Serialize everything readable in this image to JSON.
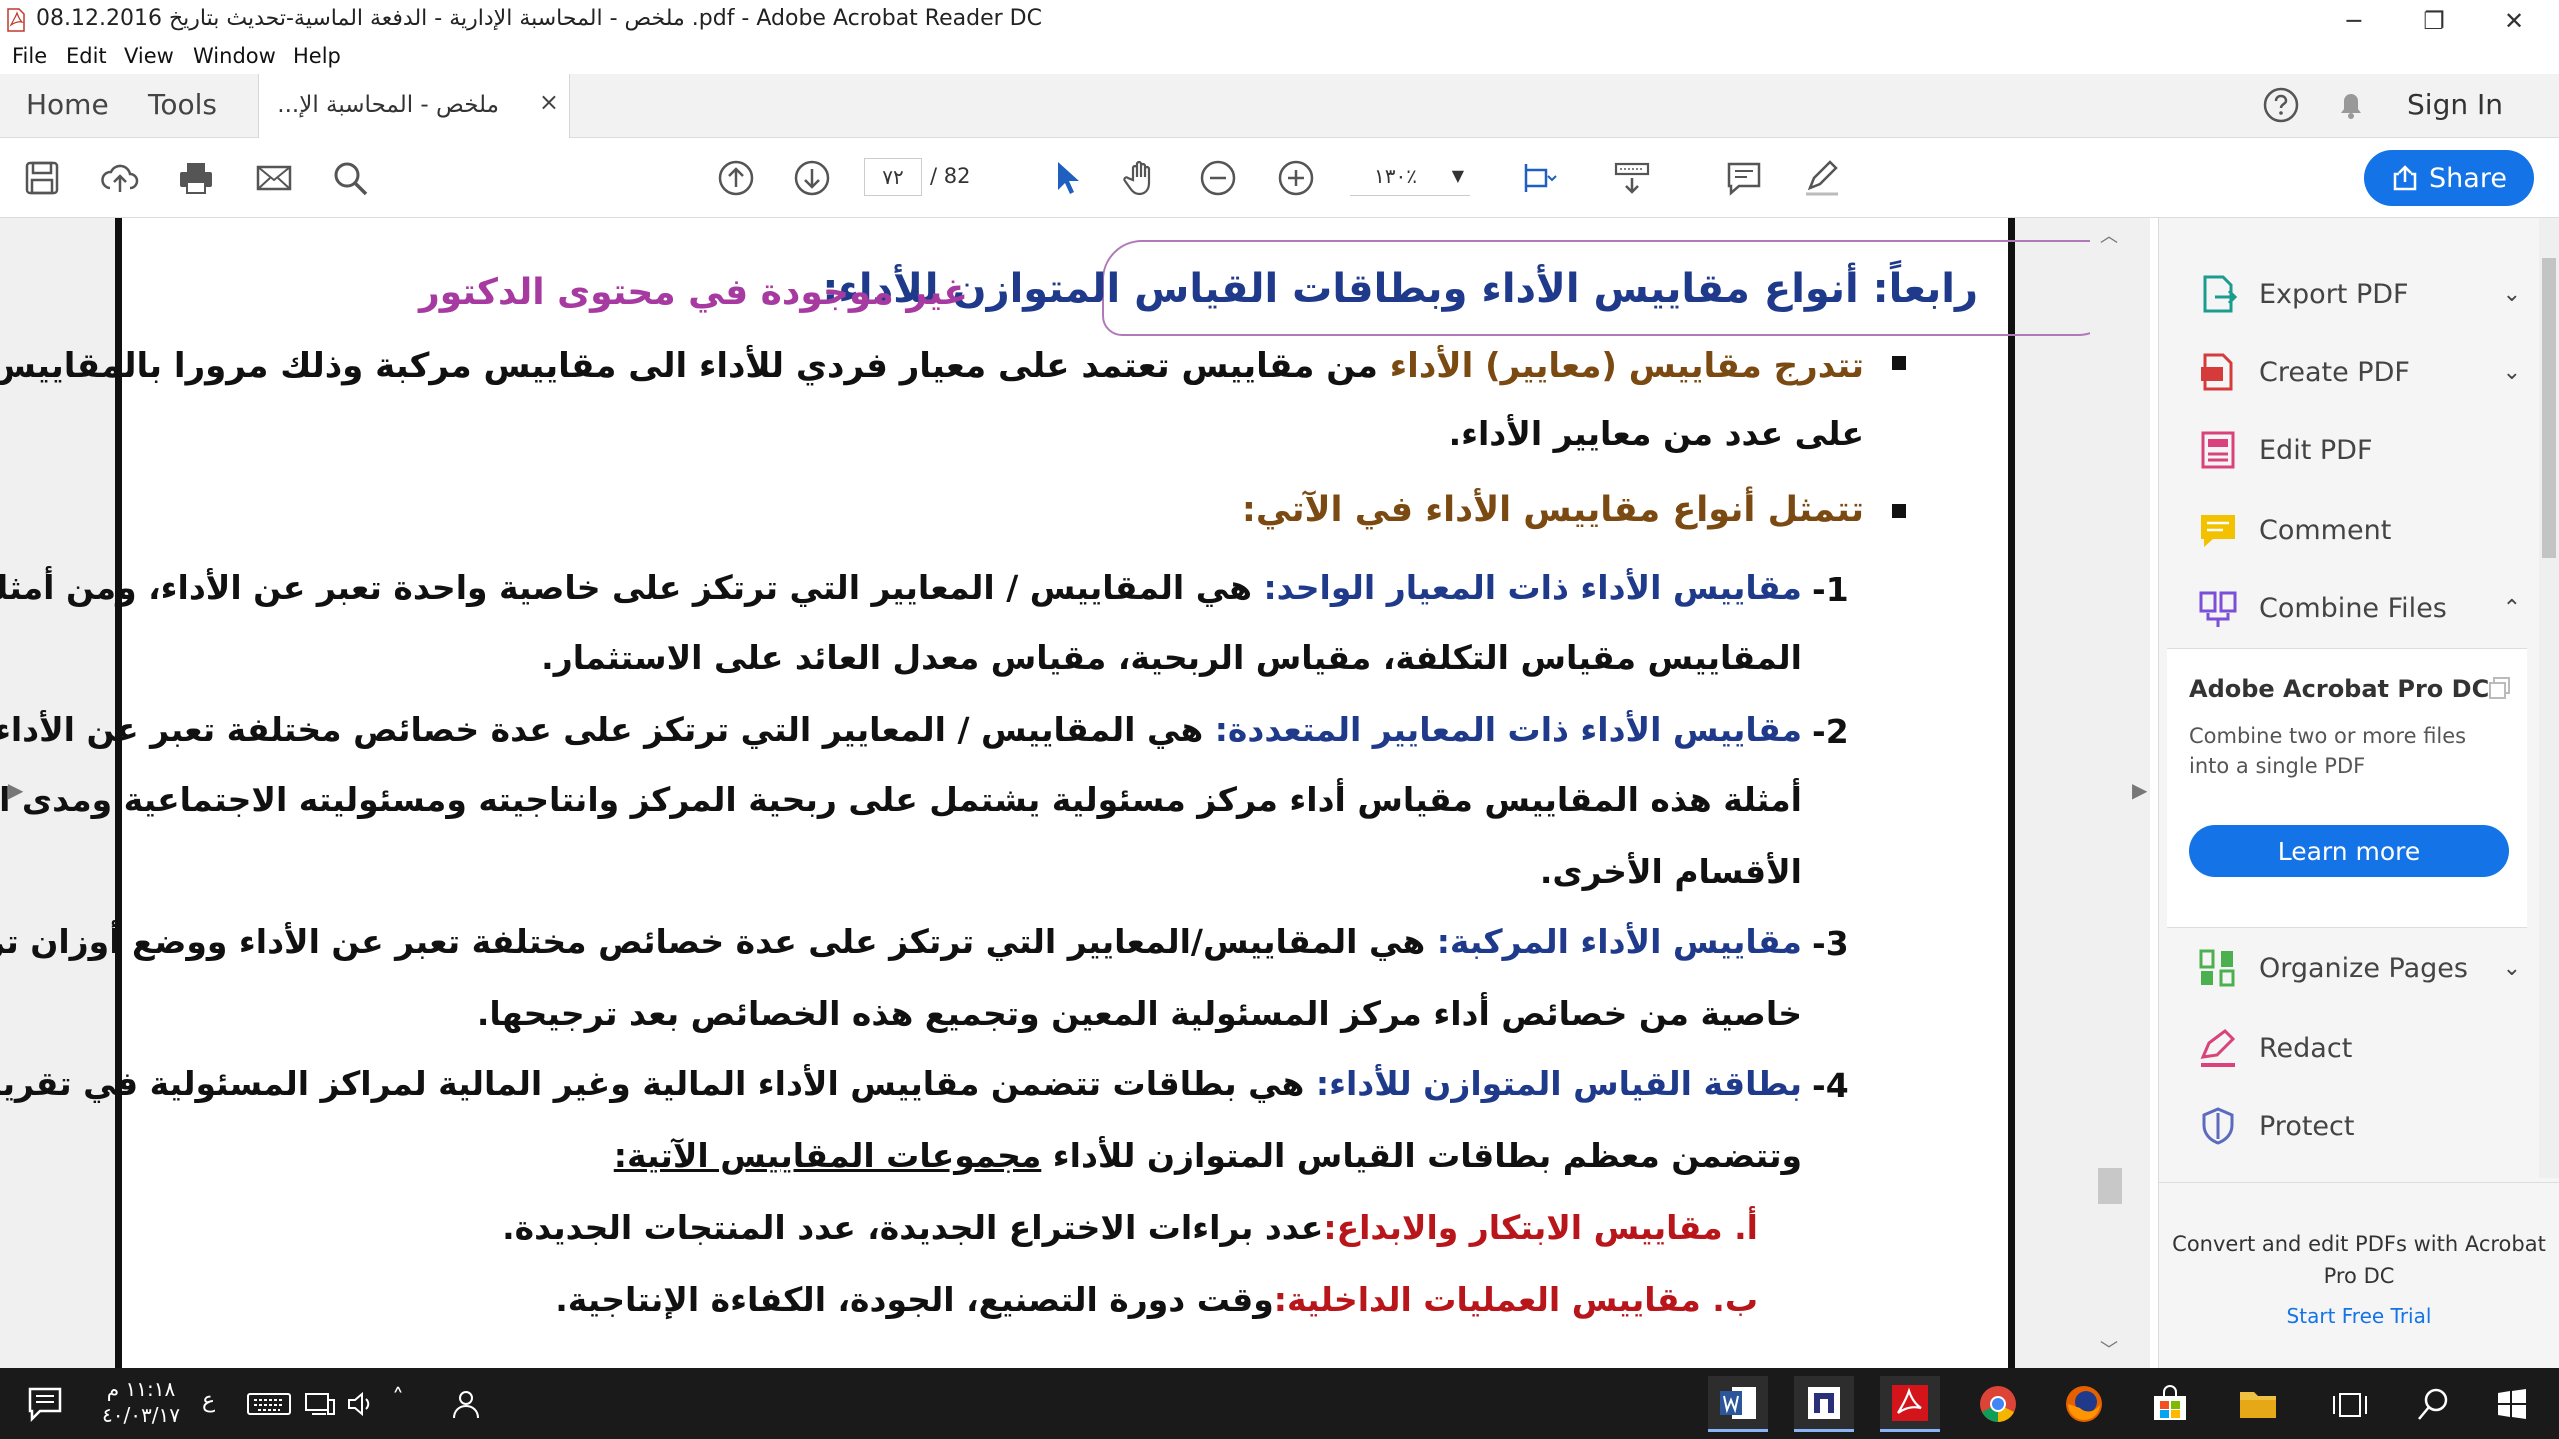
{
  "window": {
    "title": "ملخص - المحاسبة الإدارية - الدفعة الماسية-تحديث بتاريخ 08.12.2016 .pdf - Adobe Acrobat Reader DC",
    "minimize": "─",
    "restore": "❐",
    "close": "✕"
  },
  "menu": [
    "File",
    "Edit",
    "View",
    "Window",
    "Help"
  ],
  "tabs": {
    "home": "Home",
    "tools": "Tools",
    "document": "ملخص - المحاسبة الإ...",
    "close": "×",
    "signin": "Sign In"
  },
  "toolbar": {
    "page_current": "٧٢",
    "page_total": "/ 82",
    "zoom": "١٣٠٪",
    "share": "Share"
  },
  "document": {
    "heading": "رابعاً: أنواع مقاييس الأداء وبطاقات القياس المتوازن للأداء:",
    "heading_note": "غير موجودة في محتوى الدكتور",
    "para1_lead": "تتدرج مقاييس (معايير) الأداء",
    "para1_rest": " من مقاييس تعتمد على معيار فردي للأداء الى مقاييس مركبة وذلك مرورا بالمقاييس التي تعتمد",
    "para1_line2": "على عدد من معايير الأداء.",
    "para2": "تتمثل أنواع مقاييس الأداء في الآتي:",
    "item1_num": "-1",
    "item1_lead": "مقاييس الأداء ذات المعيار الواحد:",
    "item1_rest": " هي المقاييس / المعايير التي ترتكز على خاصية واحدة تعبر عن الأداء، ومن أمثلة هذه",
    "item1_line2": "المقاييس مقياس التكلفة، مقياس الربحية، مقياس معدل العائد على الاستثمار.",
    "item2_num": "-2",
    "item2_lead": "مقاييس الأداء ذات المعايير المتعددة:",
    "item2_rest": " هي المقاييس / المعايير التي ترتكز على عدة خصائص مختلفة تعبر عن الأداء، ومن",
    "item2_line2": "أمثلة هذه المقاييس مقياس أداء مركز مسئولية يشتمل على ربحية المركز وانتاجيته ومسئوليته الاجتماعية ومدى التعاون مع",
    "item2_line3": "الأقسام الأخرى.",
    "item3_num": "-3",
    "item3_lead": "مقاييس الأداء المركبة:",
    "item3_rest": " هي المقاييس/المعايير التي ترتكز على عدة خصائص مختلفة تعبر عن الأداء ووضع أوزان ترجيح لكل",
    "item3_line2": "خاصية من خصائص أداء مركز المسئولية المعين وتجميع هذه الخصائص بعد ترجيحها.",
    "item4_num": "-4",
    "item4_lead": "بطاقة القياس المتوازن للأداء:",
    "item4_rest": " هي بطاقات تتضمن مقاييس الأداء المالية وغير المالية لمراكز المسئولية في تقرير واحد،",
    "item4_line2a": "وتتضمن معظم بطاقات القياس المتوازن للأداء ",
    "item4_line2b": "مجموعات المقاييس الآتية:",
    "suba_lead": "أ.   مقاييس الابتكار والابداع:",
    "suba_rest": "عدد براءات الاختراع الجديدة، عدد المنتجات الجديدة.",
    "subb_lead": "ب.  مقاييس العمليات الداخلية:",
    "subb_rest": "وقت دورة التصنيع، الجودة، الكفاءة الإنتاجية."
  },
  "right_pane": {
    "items": [
      {
        "label": "Export PDF",
        "icon": "export-pdf-icon",
        "chevron": "⌄"
      },
      {
        "label": "Create PDF",
        "icon": "create-pdf-icon",
        "chevron": "⌄"
      },
      {
        "label": "Edit PDF",
        "icon": "edit-pdf-icon",
        "chevron": ""
      },
      {
        "label": "Comment",
        "icon": "comment-icon",
        "chevron": ""
      },
      {
        "label": "Combine Files",
        "icon": "combine-files-icon",
        "chevron": "⌃"
      }
    ],
    "promo_title": "Adobe Acrobat Pro DC",
    "promo_desc": "Combine two or more files into a single PDF",
    "promo_button": "Learn more",
    "items2": [
      {
        "label": "Organize Pages",
        "icon": "organize-pages-icon",
        "chevron": "⌄"
      },
      {
        "label": "Redact",
        "icon": "redact-icon",
        "chevron": ""
      },
      {
        "label": "Protect",
        "icon": "protect-icon",
        "chevron": ""
      }
    ],
    "footer": "Convert and edit PDFs with Acrobat Pro DC",
    "footer_link": "Start Free Trial"
  },
  "taskbar": {
    "time": "١١:١٨ م",
    "date": "٤٠/٠٣/١٧",
    "lang": "ع"
  },
  "colors": {
    "accent": "#1473e6",
    "heading_blue": "#1f3a8a",
    "heading_brown": "#7a4a12",
    "note_purple": "#a63aa0",
    "sub_red": "#b8161b"
  }
}
